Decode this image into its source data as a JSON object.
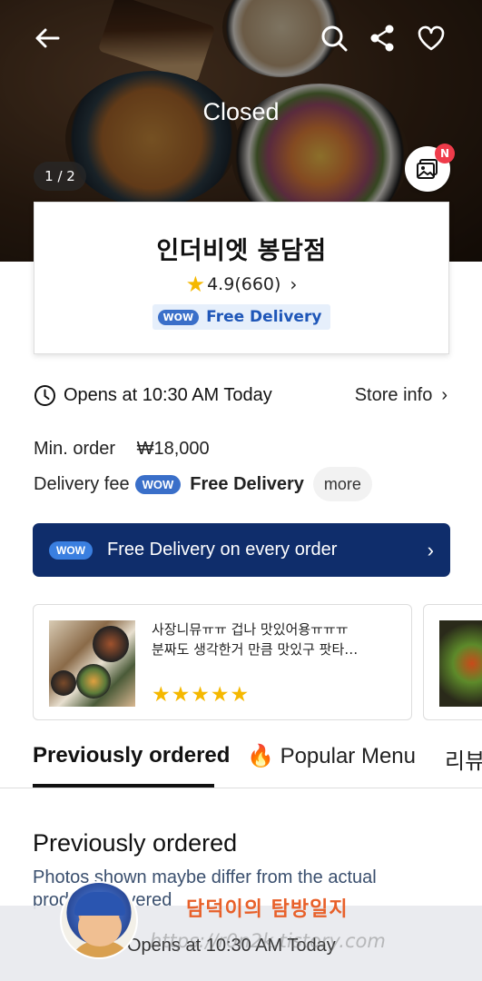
{
  "header": {
    "status_label": "Closed",
    "photo_counter": "1 / 2",
    "gallery_badge": "N"
  },
  "store": {
    "name": "인더비엣 봉담점",
    "rating": "4.9",
    "review_count": "(660)",
    "wow_label": "WOW",
    "free_delivery_label": "Free Delivery"
  },
  "info": {
    "hours": "Opens at 10:30 AM Today",
    "store_info_label": "Store info",
    "min_order_label": "Min. order",
    "min_order_value": "₩18,000",
    "delivery_fee_label": "Delivery fee",
    "delivery_fee_value": "Free Delivery",
    "more_label": "more"
  },
  "banner": {
    "text": "Free Delivery on every order"
  },
  "reviews": [
    {
      "line1": "사장니뮤ㅠㅠ 겁나 맛있어용ㅠㅠㅠ",
      "line2": "분짜도 생각한거 만큼 맛있구 팟타…",
      "stars": "★★★★★"
    }
  ],
  "tabs": [
    {
      "label": "Previously ordered"
    },
    {
      "label": "Popular Menu",
      "emoji": "🔥"
    },
    {
      "label": "리뷰"
    }
  ],
  "section": {
    "title": "Previously ordered",
    "subtitle": "Photos shown maybe differ from the actual product delivered"
  },
  "overlay": {
    "bottom_hours": "Opens at 10:30 AM Today",
    "watermark_title": "담덕이의 탐방일지",
    "watermark_url": "https://r0n2k.tistory.com"
  },
  "colors": {
    "wow_blue": "#3a6fc9",
    "banner_navy": "#0f2d6b",
    "star_yellow": "#f5b800",
    "badge_red": "#ef3b4a"
  }
}
